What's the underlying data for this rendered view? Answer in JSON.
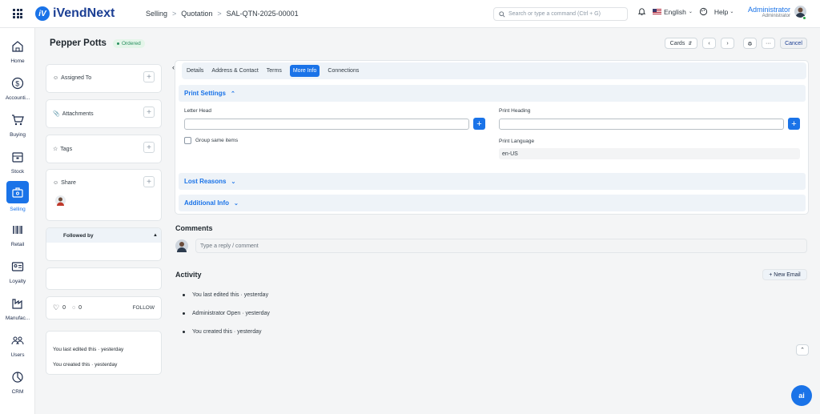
{
  "app": {
    "name": "iVendNext",
    "logo_mark": "iV"
  },
  "breadcrumb": [
    "Selling",
    "Quotation",
    "SAL-QTN-2025-00001"
  ],
  "search": {
    "placeholder": "Search or type a command (Ctrl + G)"
  },
  "topbar": {
    "language": "English",
    "help": "Help",
    "user_name": "Administrator",
    "user_role": "Administrator"
  },
  "sidebar": [
    {
      "label": "Home",
      "icon": "home-icon"
    },
    {
      "label": "Accounti...",
      "icon": "dollar-icon"
    },
    {
      "label": "Buying",
      "icon": "cart-icon"
    },
    {
      "label": "Stock",
      "icon": "box-icon"
    },
    {
      "label": "Selling",
      "icon": "briefcase-icon",
      "active": true
    },
    {
      "label": "Retail",
      "icon": "barcode-icon"
    },
    {
      "label": "Loyalty",
      "icon": "id-card-icon"
    },
    {
      "label": "Manufac...",
      "icon": "factory-icon"
    },
    {
      "label": "Users",
      "icon": "users-icon"
    },
    {
      "label": "CRM",
      "icon": "crm-icon"
    }
  ],
  "doc": {
    "title": "Pepper Potts",
    "status": "Ordered"
  },
  "actions": {
    "cards": "Cards",
    "cancel": "Cancel",
    "more": "···"
  },
  "left": {
    "assigned_to": "Assigned To",
    "attachments": "Attachments",
    "tags": "Tags",
    "share": "Share",
    "followed_by": "Followed by",
    "likes": "0",
    "comments": "0",
    "follow": "FOLLOW",
    "edited": "You last edited this · yesterday",
    "created": "You created this · yesterday"
  },
  "tabs": [
    "Details",
    "Address & Contact",
    "Terms",
    "More Info",
    "Connections"
  ],
  "active_tab": "More Info",
  "print": {
    "section": "Print Settings",
    "letter_head": "Letter Head",
    "print_heading": "Print Heading",
    "group_same": "Group same items",
    "print_language": "Print Language",
    "language_value": "en-US"
  },
  "sections": {
    "lost_reasons": "Lost Reasons",
    "additional_info": "Additional Info"
  },
  "comments": {
    "title": "Comments",
    "placeholder": "Type a reply / comment"
  },
  "activity": {
    "title": "Activity",
    "new_email": "+ New Email",
    "items": [
      "You last edited this · yesterday",
      "Administrator Open · yesterday",
      "You created this · yesterday"
    ]
  },
  "ai_label": "ai",
  "colors": {
    "accent": "#1a73e8",
    "status": "#278f5e"
  }
}
